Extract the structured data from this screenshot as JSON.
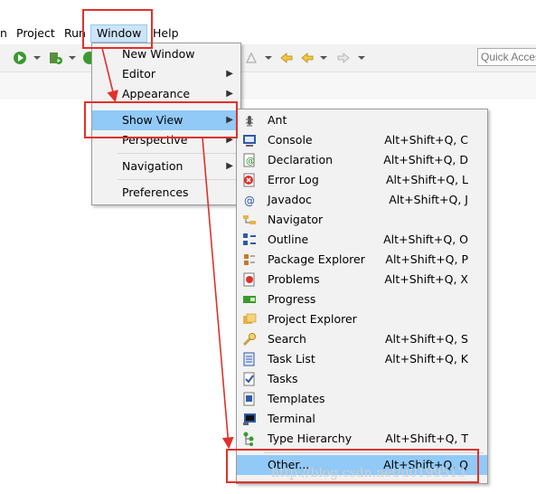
{
  "menubar": {
    "items": [
      {
        "label": "n"
      },
      {
        "label": "Project"
      },
      {
        "label": "Run"
      },
      {
        "label": "Window"
      },
      {
        "label": "Help"
      }
    ]
  },
  "toolbar": {
    "quick_access_placeholder": "Quick Access"
  },
  "window_menu": {
    "items": [
      {
        "label": "New Window"
      },
      {
        "label": "Editor"
      },
      {
        "label": "Appearance"
      },
      {
        "label": "Show View"
      },
      {
        "label": "Perspective"
      },
      {
        "label": "Navigation"
      },
      {
        "label": "Preferences"
      }
    ]
  },
  "show_view_menu": {
    "items": [
      {
        "label": "Ant",
        "shortcut": "",
        "icon": "ant-icon"
      },
      {
        "label": "Console",
        "shortcut": "Alt+Shift+Q, C",
        "icon": "console-icon"
      },
      {
        "label": "Declaration",
        "shortcut": "Alt+Shift+Q, D",
        "icon": "declaration-icon"
      },
      {
        "label": "Error Log",
        "shortcut": "Alt+Shift+Q, L",
        "icon": "error-log-icon"
      },
      {
        "label": "Javadoc",
        "shortcut": "Alt+Shift+Q, J",
        "icon": "javadoc-icon"
      },
      {
        "label": "Navigator",
        "shortcut": "",
        "icon": "navigator-icon"
      },
      {
        "label": "Outline",
        "shortcut": "Alt+Shift+Q, O",
        "icon": "outline-icon"
      },
      {
        "label": "Package Explorer",
        "shortcut": "Alt+Shift+Q, P",
        "icon": "package-explorer-icon"
      },
      {
        "label": "Problems",
        "shortcut": "Alt+Shift+Q, X",
        "icon": "problems-icon"
      },
      {
        "label": "Progress",
        "shortcut": "",
        "icon": "progress-icon"
      },
      {
        "label": "Project Explorer",
        "shortcut": "",
        "icon": "project-explorer-icon"
      },
      {
        "label": "Search",
        "shortcut": "Alt+Shift+Q, S",
        "icon": "search-icon"
      },
      {
        "label": "Task List",
        "shortcut": "Alt+Shift+Q, K",
        "icon": "task-list-icon"
      },
      {
        "label": "Tasks",
        "shortcut": "",
        "icon": "tasks-icon"
      },
      {
        "label": "Templates",
        "shortcut": "",
        "icon": "templates-icon"
      },
      {
        "label": "Terminal",
        "shortcut": "",
        "icon": "terminal-icon"
      },
      {
        "label": "Type Hierarchy",
        "shortcut": "Alt+Shift+Q, T",
        "icon": "type-hierarchy-icon"
      },
      {
        "label": "Other...",
        "shortcut": "Alt+Shift+Q, Q",
        "icon": ""
      }
    ]
  },
  "watermark": "http://blog.csdn.net/u0199513",
  "colors": {
    "highlight": "#91c9f7",
    "annotation_red": "#e0312a",
    "menu_bg": "#f2f2f2"
  }
}
